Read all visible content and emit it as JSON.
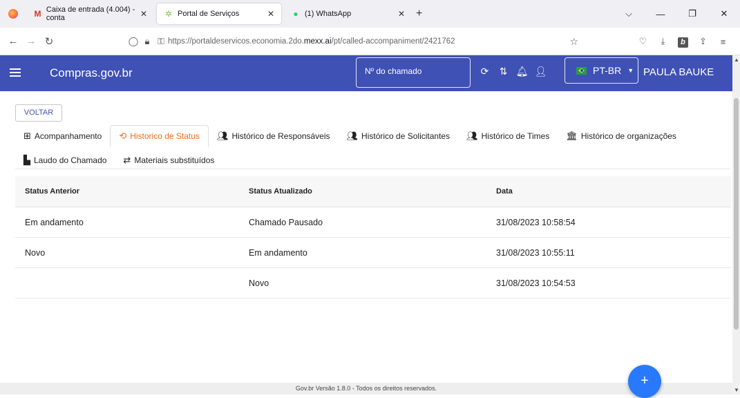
{
  "browser": {
    "tabs": [
      {
        "title": "Caixa de entrada (4.004) - conta",
        "icon": "gmail-icon"
      },
      {
        "title": "Portal de Serviços",
        "icon": "portal-icon"
      },
      {
        "title": "(1) WhatsApp",
        "icon": "whatsapp-icon"
      }
    ],
    "url_prefix": "https://portaldeservicos.economia.2do.",
    "url_host": "mexx.ai",
    "url_path": "/pt/called-accompaniment/2421762"
  },
  "header": {
    "brand": "Compras.gov.br",
    "chamado_placeholder": "Nº do chamado",
    "language": "PT-BR",
    "user": "PAULA BAUKE"
  },
  "back_button": "VOLTAR",
  "tabs": {
    "acompanhamento": "Acompanhamento",
    "historico_status": "Historico de Status",
    "historico_responsaveis": "Histórico de Responsáveis",
    "historico_solicitantes": "Histórico de Solicitantes",
    "historico_times": "Histórico de Times",
    "historico_organizacoes": "Histórico de organizações",
    "laudo": "Laudo do Chamado",
    "materiais": "Materiais substituídos"
  },
  "table": {
    "headers": [
      "Status Anterior",
      "Status Atualizado",
      "Data"
    ],
    "rows": [
      [
        "Em andamento",
        "Chamado Pausado",
        "31/08/2023 10:58:54"
      ],
      [
        "Novo",
        "Em andamento",
        "31/08/2023 10:55:11"
      ],
      [
        "",
        "Novo",
        "31/08/2023 10:54:53"
      ]
    ]
  },
  "footer": "Gov.br Versão 1.8.0 - Todos os direitos reservados.",
  "fab_label": "+",
  "colors": {
    "appbar": "#3f51b5",
    "active_tab": "#f06a1a",
    "fab": "#2979ff"
  }
}
